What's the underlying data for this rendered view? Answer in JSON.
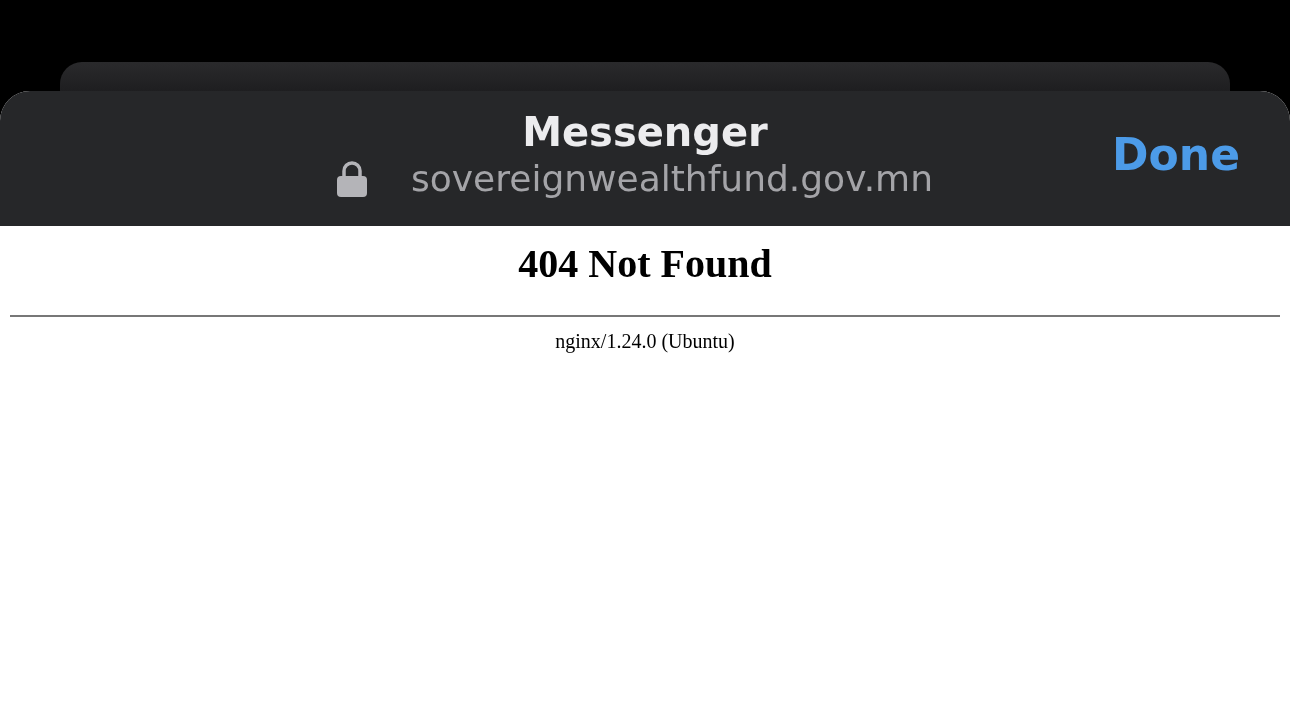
{
  "sheet": {
    "title": "Messenger",
    "url": "sovereignwealthfund.gov.mn",
    "done_button": "Done"
  },
  "page": {
    "heading": "404 Not Found",
    "server": "nginx/1.24.0 (Ubuntu)"
  }
}
